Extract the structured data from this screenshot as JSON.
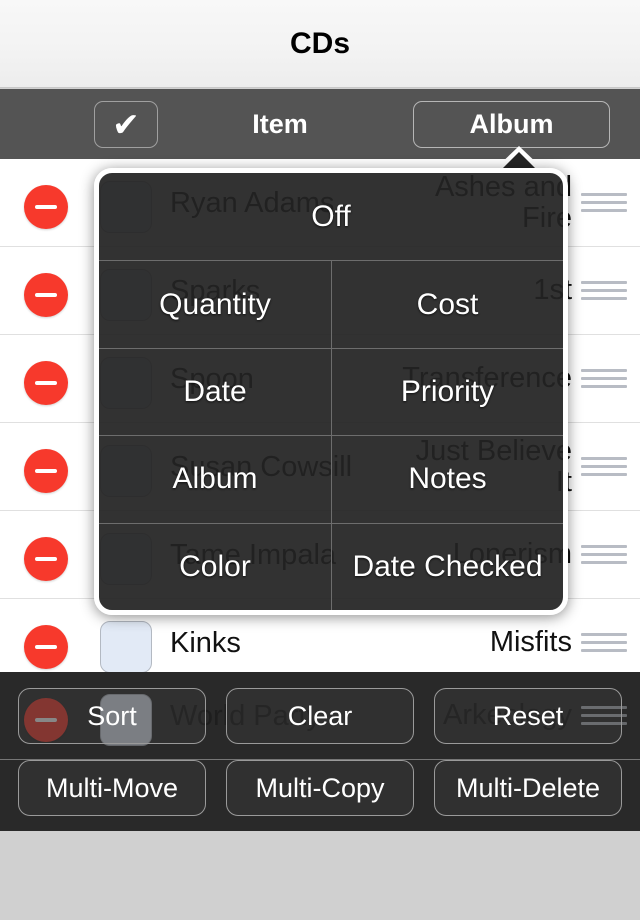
{
  "header": {
    "title": "CDs"
  },
  "mode_bar": {
    "check_icon": "checkmark-icon",
    "check_glyph": "✔",
    "item_label": "Item",
    "album_label": "Album",
    "active": "Album"
  },
  "list": {
    "rows": [
      {
        "title": "Ryan Adams",
        "album": "Ashes and Fire",
        "checked": false
      },
      {
        "title": "Sparks",
        "album": "1st",
        "checked": false
      },
      {
        "title": "Spoon",
        "album": "Transference",
        "checked": false
      },
      {
        "title": "Susan Cowsill",
        "album": "Just Believe It",
        "checked": false
      },
      {
        "title": "Tame Impala",
        "album": "Lonerism",
        "checked": false
      },
      {
        "title": "Kinks",
        "album": "Misfits",
        "checked": false
      }
    ],
    "peek_row": {
      "title": "World Party",
      "album": "Arkeology"
    }
  },
  "popup": {
    "rows": [
      {
        "cells": [
          "Off"
        ]
      },
      {
        "cells": [
          "Quantity",
          "Cost"
        ]
      },
      {
        "cells": [
          "Date",
          "Priority"
        ]
      },
      {
        "cells": [
          "Album",
          "Notes"
        ]
      },
      {
        "cells": [
          "Color",
          "Date Checked"
        ]
      }
    ]
  },
  "action_bar": {
    "buttons": [
      "Sort",
      "Clear",
      "Reset",
      "Multi-Move",
      "Multi-Copy",
      "Multi-Delete"
    ]
  },
  "colors": {
    "delete_red": "#f7392c",
    "toolbar_gray": "#545454",
    "popup_bg": "#222222",
    "action_bar_bg": "#1c1c1c",
    "checkbox_fill": "#e2eaf6",
    "bottom_strip": "#d0d0d0"
  }
}
